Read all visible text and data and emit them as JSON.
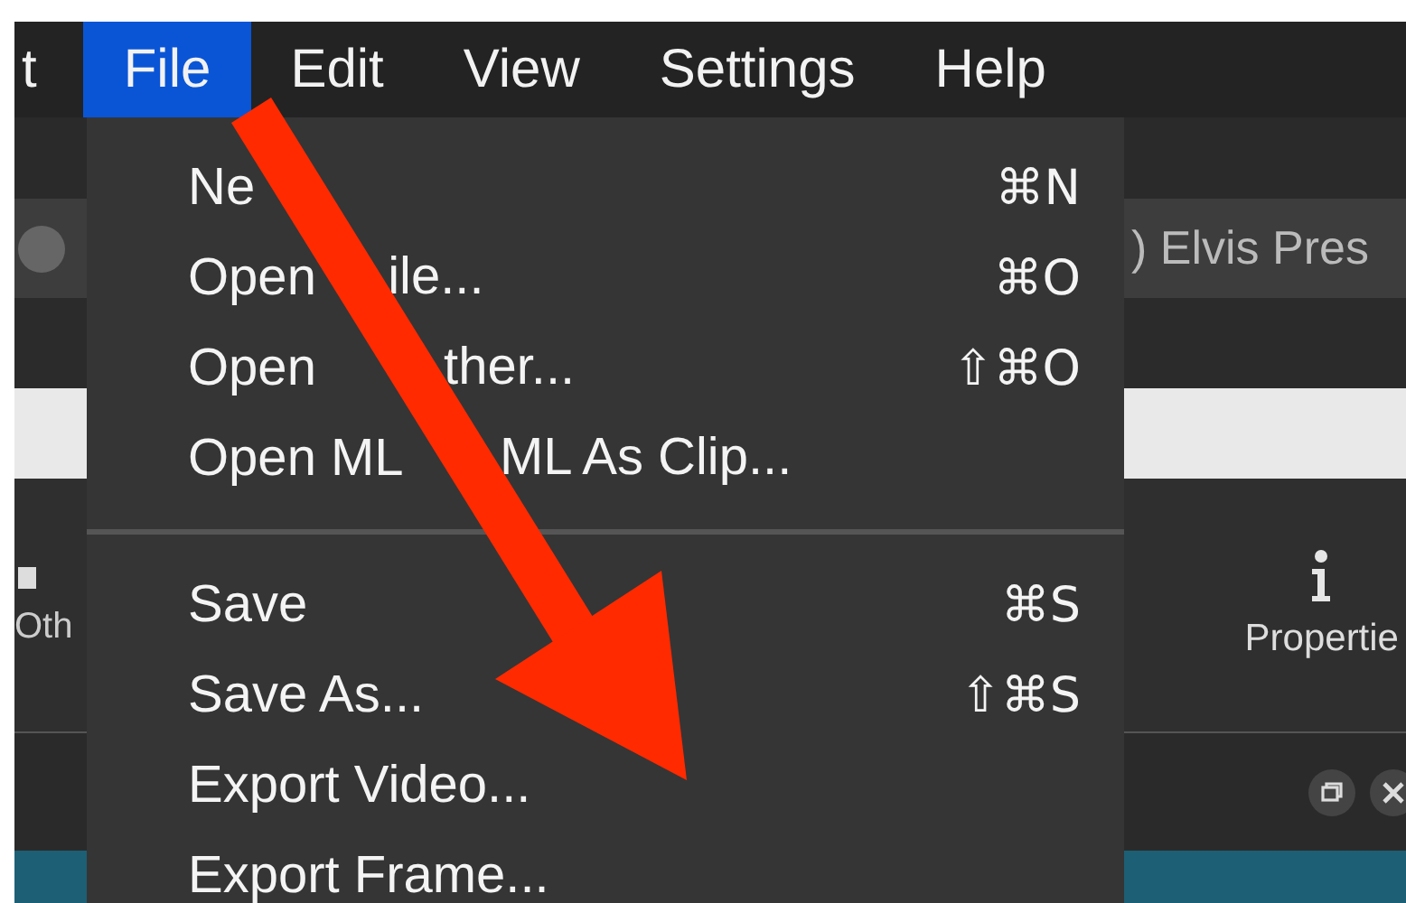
{
  "menu_bar": {
    "items": [
      {
        "label": "t",
        "selected": false
      },
      {
        "label": "File",
        "selected": true
      },
      {
        "label": "Edit",
        "selected": false
      },
      {
        "label": "View",
        "selected": false
      },
      {
        "label": "Settings",
        "selected": false
      },
      {
        "label": "Help",
        "selected": false
      }
    ]
  },
  "file_menu": {
    "items": [
      {
        "kind": "split",
        "label": "Ne",
        "shortcut": "⌘N"
      },
      {
        "kind": "split",
        "label": "Open",
        "label_after": "ile...",
        "shortcut": "⌘O"
      },
      {
        "kind": "split",
        "label": "Open",
        "label_after": "ther...",
        "shortcut": "⇧⌘O"
      },
      {
        "kind": "split",
        "label": "Open ML",
        "label_after": "ML As Clip..."
      },
      {
        "kind": "separator"
      },
      {
        "kind": "item",
        "label": "Save",
        "shortcut": "⌘S"
      },
      {
        "kind": "item",
        "label": "Save As...",
        "shortcut": "⇧⌘S"
      },
      {
        "kind": "item",
        "label": "Export Video..."
      },
      {
        "kind": "item",
        "label": "Export Frame..."
      }
    ]
  },
  "background_app": {
    "clip_title": ") Elvis Pres",
    "left_tab_label": "Oth",
    "properties_label": "Propertie"
  }
}
